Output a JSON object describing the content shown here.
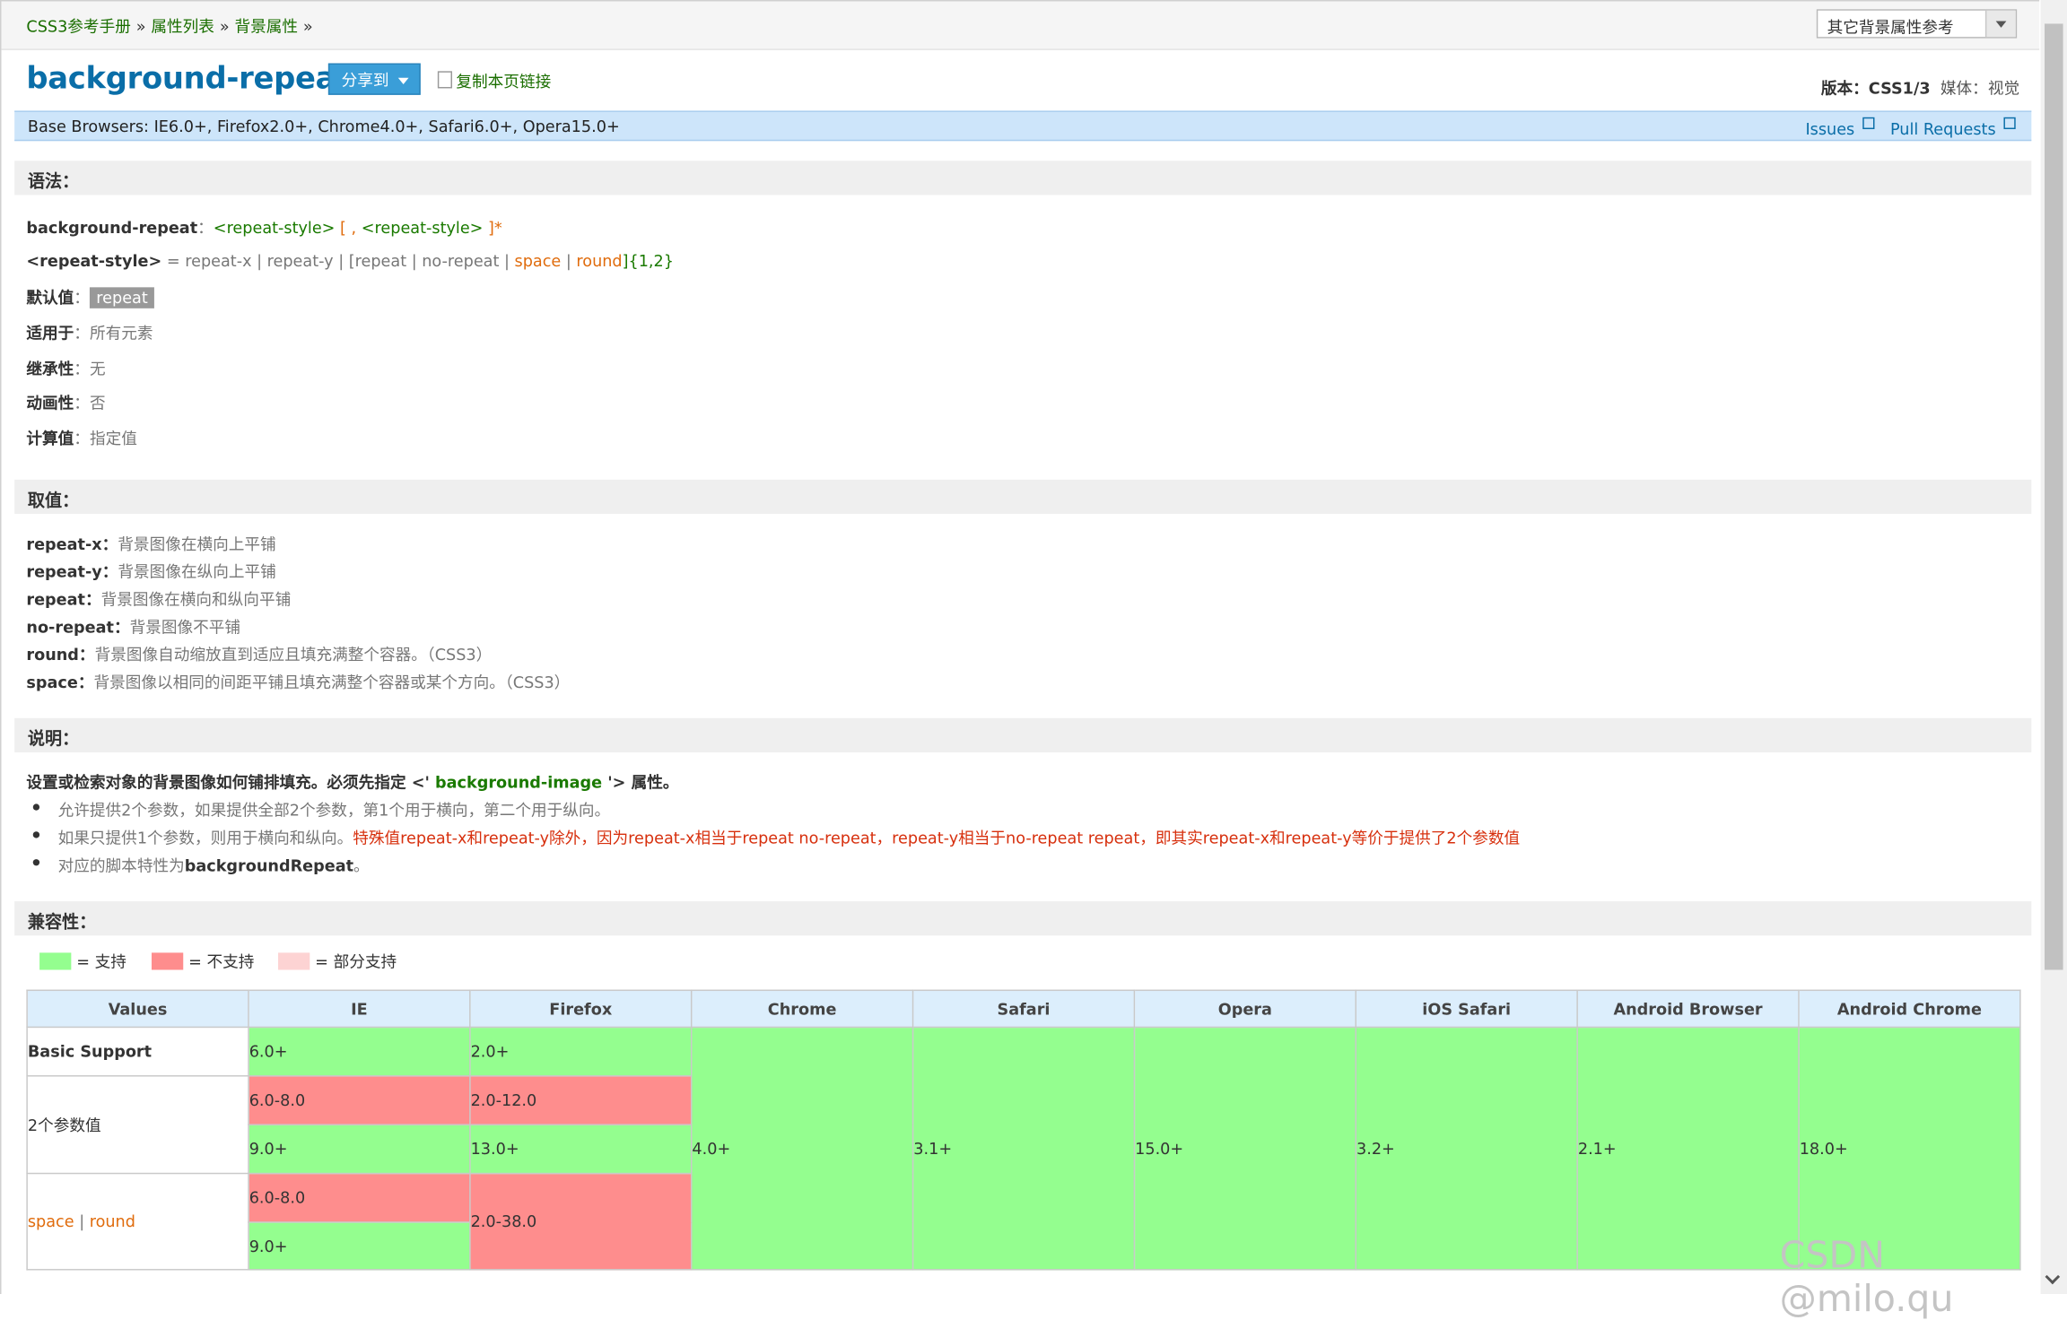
{
  "breadcrumb": {
    "items": [
      "CSS3参考手册",
      "属性列表",
      "背景属性"
    ],
    "sep": "»"
  },
  "select": {
    "value": "其它背景属性参考"
  },
  "header": {
    "title": "background-repeat",
    "share_label": "分享到",
    "copy_label": "复制本页链接",
    "version_label": "版本：",
    "version_value": "CSS1/3",
    "media_label": "媒体：",
    "media_value": "视觉"
  },
  "browsers": {
    "text": "Base Browsers: IE6.0+, Firefox2.0+, Chrome4.0+, Safari6.0+, Opera15.0+",
    "issues": "Issues",
    "pull_requests": "Pull Requests"
  },
  "syntax": {
    "heading": "语法：",
    "line1_prop": "background-repeat",
    "line1_colon": "：",
    "line1_a": "<repeat-style>",
    "line1_b": " [ , ",
    "line1_c": "<repeat-style>",
    "line1_d": " ]*",
    "line2_term": "<repeat-style>",
    "line2_eq": " = repeat-x | repeat-y | [repeat | no-repeat | ",
    "line2_space": "space",
    "line2_bar": " | ",
    "line2_round": "round",
    "line2_end": "]{1,2}",
    "default_label": "默认值",
    "default_value": "repeat",
    "applies_label": "适用于",
    "applies_value": "所有元素",
    "inherit_label": "继承性",
    "inherit_value": "无",
    "anim_label": "动画性",
    "anim_value": "否",
    "computed_label": "计算值",
    "computed_value": "指定值",
    "colon": "："
  },
  "values": {
    "heading": "取值：",
    "items": [
      {
        "term": "repeat-x",
        "desc": "背景图像在横向上平铺"
      },
      {
        "term": "repeat-y",
        "desc": "背景图像在纵向上平铺"
      },
      {
        "term": "repeat",
        "desc": "背景图像在横向和纵向平铺"
      },
      {
        "term": "no-repeat",
        "desc": "背景图像不平铺"
      },
      {
        "term": "round",
        "desc": "背景图像自动缩放直到适应且填充满整个容器。（CSS3）"
      },
      {
        "term": "space",
        "desc": "背景图像以相同的间距平铺且填充满整个容器或某个方向。（CSS3）"
      }
    ]
  },
  "description": {
    "heading": "说明：",
    "intro_a": "设置或检索对象的背景图像如何铺排填充。必须先指定 <' ",
    "intro_link": "background-image",
    "intro_b": " '> 属性。",
    "bullet1": "允许提供2个参数，如果提供全部2个参数，第1个用于横向，第二个用于纵向。",
    "bullet2_a": "如果只提供1个参数，则用于横向和纵向。",
    "bullet2_red": "特殊值repeat-x和repeat-y除外，因为repeat-x相当于repeat no-repeat，repeat-y相当于no-repeat repeat，即其实repeat-x和repeat-y等价于提供了2个参数值",
    "bullet3_a": "对应的脚本特性为",
    "bullet3_b": "backgroundRepeat",
    "bullet3_c": "。"
  },
  "compat": {
    "heading": "兼容性：",
    "legend": [
      "= 支持",
      "= 不支持",
      "= 部分支持"
    ],
    "colors": {
      "support": "#94fe8f",
      "no_support": "#fe8d8d",
      "partial": "#fdd3d3"
    },
    "headers": [
      "Values",
      "IE",
      "Firefox",
      "Chrome",
      "Safari",
      "Opera",
      "iOS Safari",
      "Android Browser",
      "Android Chrome"
    ],
    "row_basic": "Basic Support",
    "row_two": "2个参数值",
    "row_space": "space",
    "row_bar": " | ",
    "row_round": "round",
    "ie_basic": "6.0+",
    "ff_basic": "2.0+",
    "ie_two_no": "6.0-8.0",
    "ff_two_no": "2.0-12.0",
    "ie_two_yes": "9.0+",
    "ff_two_yes": "13.0+",
    "ie_space_no": "6.0-8.0",
    "ie_space_yes": "9.0+",
    "ff_space_no": "2.0-38.0",
    "chrome": "4.0+",
    "safari": "3.1+",
    "opera": "15.0+",
    "ios": "3.2+",
    "android": "2.1+",
    "android_chrome": "18.0+"
  },
  "watermark": "CSDN @milo.qu"
}
